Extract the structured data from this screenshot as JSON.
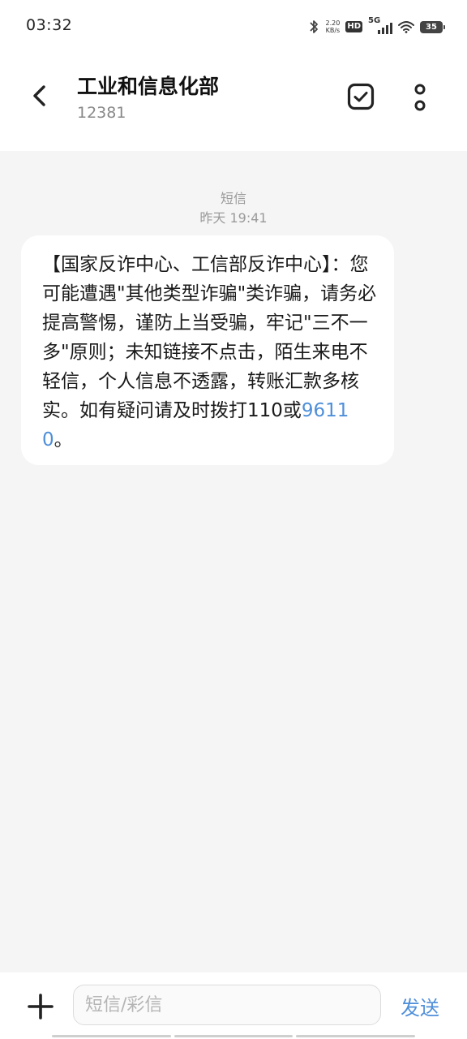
{
  "status_bar": {
    "time": "03:32",
    "net_speed_value": "2.20",
    "net_speed_unit": "KB/s",
    "hd_label": "HD",
    "network_label": "5G",
    "battery_level": "35"
  },
  "header": {
    "contact_name": "工业和信息化部",
    "contact_number": "12381"
  },
  "conversation": {
    "message_type": "短信",
    "timestamp": "昨天 19:41",
    "message": {
      "text_before_link": "【国家反诈中心、工信部反诈中心】：您可能遭遇\"其他类型诈骗\"类诈骗，请务必提高警惕，谨防上当受骗，牢记\"三不一多\"原则；未知链接不点击，陌生来电不轻信，个人信息不透露，转账汇款多核实。如有疑问请及时拨打110或",
      "link_number": "96110",
      "text_after_link": "。"
    }
  },
  "composer": {
    "placeholder": "短信/彩信",
    "send_label": "发送"
  },
  "colors": {
    "accent": "#4f8fd9",
    "background": "#f5f5f5",
    "bubble": "#ffffff"
  }
}
